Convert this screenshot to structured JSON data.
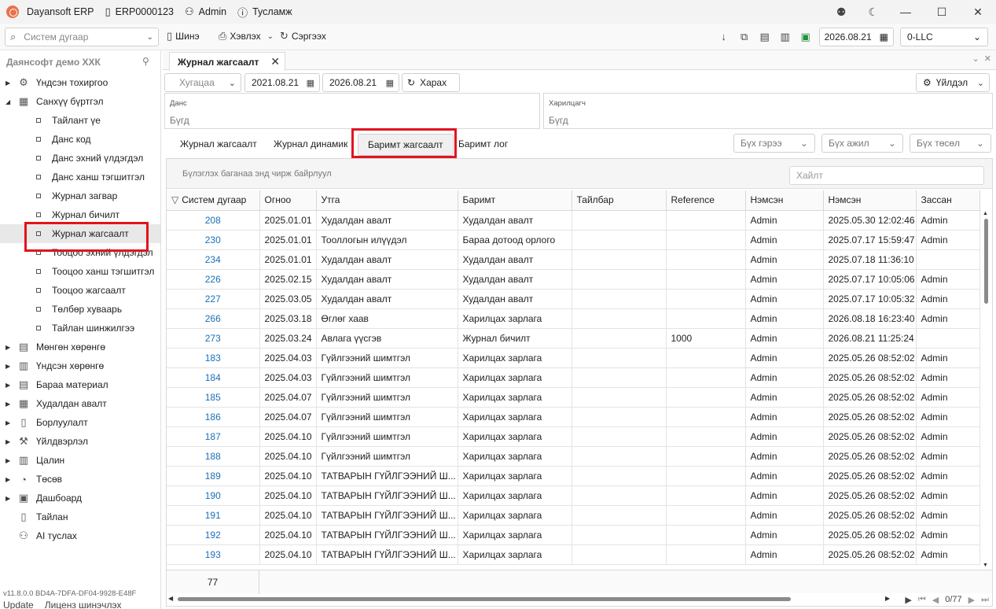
{
  "titlebar": {
    "app_name": "Dayansoft ERP",
    "db_name": "ERP0000123",
    "user": "Admin",
    "help": "Тусламж",
    "minimize": "—",
    "maximize": "☐",
    "close": "✕"
  },
  "toolbar": {
    "search_placeholder": "Систем дугаар",
    "new_label": "Шинэ",
    "print_label": "Хэвлэх",
    "refresh_label": "Сэргээх",
    "work_date": "2026.08.21",
    "company": "0-LLC"
  },
  "sidebar": {
    "title": "Даянсофт демо ХХК",
    "items": [
      {
        "label": "Үндсэн тохиргоо",
        "icon": "gear-icon",
        "glyph": "⚙",
        "arrow": "▶"
      },
      {
        "label": "Санхүү бүртгэл",
        "icon": "ledger-icon",
        "glyph": "▦",
        "arrow": "◢"
      },
      {
        "label": "Мөнгөн хөрөнгө",
        "icon": "money-icon",
        "glyph": "▤",
        "arrow": "▶"
      },
      {
        "label": "Үндсэн хөрөнгө",
        "icon": "asset-icon",
        "glyph": "▥",
        "arrow": "▶"
      },
      {
        "label": "Бараа материал",
        "icon": "inventory-icon",
        "glyph": "▤",
        "arrow": "▶"
      },
      {
        "label": "Худалдан авалт",
        "icon": "purchase-icon",
        "glyph": "▦",
        "arrow": "▶"
      },
      {
        "label": "Борлуулалт",
        "icon": "sales-icon",
        "glyph": "▯",
        "arrow": "▶"
      },
      {
        "label": "Үйлдвэрлэл",
        "icon": "production-icon",
        "glyph": "⚒",
        "arrow": "▶"
      },
      {
        "label": "Цалин",
        "icon": "salary-icon",
        "glyph": "▥",
        "arrow": "▶"
      },
      {
        "label": "Төсөв",
        "icon": "budget-icon",
        "glyph": "◔",
        "arrow": "▶"
      },
      {
        "label": "Дашбоард",
        "icon": "dashboard-icon",
        "glyph": "▣",
        "arrow": "▶"
      },
      {
        "label": "Тайлан",
        "icon": "report-icon",
        "glyph": "▯",
        "arrow": ""
      },
      {
        "label": "AI туслах",
        "icon": "ai-assistant-icon",
        "glyph": "⚇",
        "arrow": ""
      }
    ],
    "children": [
      "Тайлант үе",
      "Данс код",
      "Данс эхний үлдэгдэл",
      "Данс ханш тэгшитгэл",
      "Журнал загвар",
      "Журнал бичилт",
      "Журнал жагсаалт",
      "Тооцоо эхний үлдэгдэл",
      "Тооцоо ханш тэгшитгэл",
      "Тооцоо жагсаалт",
      "Төлбөр хуваарь",
      "Тайлан шинжилгээ"
    ],
    "version": "v11.8.0.0   BD4A-7DFA-DF04-9928-E48F",
    "update_label": "Update",
    "license_label": "Лиценз шинэчлэх"
  },
  "tab": {
    "title": "Журнал жагсаалт"
  },
  "filters": {
    "period_placeholder": "Хугацаа",
    "date_from": "2021.08.21",
    "date_to": "2026.08.21",
    "show_label": "Харах",
    "action_label": "Үйлдэл",
    "account_label": "Данс",
    "account_value": "Бүгд",
    "partner_label": "Харилцагч",
    "partner_value": "Бүгд"
  },
  "sub_tabs": [
    "Журнал жагсаалт",
    "Журнал динамик",
    "Баримт жагсаалт",
    "Баримт лог"
  ],
  "dropdowns": [
    "Бүх гэрээ",
    "Бүх ажил",
    "Бүх төсөл"
  ],
  "grid": {
    "group_hint": "Бүлэглэх баганаа энд чирж байрлуул",
    "search_placeholder": "Хайлт",
    "columns": [
      "Систем дугаар",
      "Огноо",
      "Утга",
      "Баримт",
      "Тайлбар",
      "Reference",
      "Нэмсэн",
      "Нэмсэн",
      "Зассан"
    ],
    "rows": [
      [
        "208",
        "2025.01.01",
        "Худалдан авалт",
        "Худалдан авалт",
        "",
        "",
        "Admin",
        "2025.05.30 12:02:46",
        "Admin"
      ],
      [
        "230",
        "2025.01.01",
        "Тооллогын илүүдэл",
        "Бараа дотоод орлого",
        "",
        "",
        "Admin",
        "2025.07.17 15:59:47",
        "Admin"
      ],
      [
        "234",
        "2025.01.01",
        "Худалдан авалт",
        "Худалдан авалт",
        "",
        "",
        "Admin",
        "2025.07.18 11:36:10",
        ""
      ],
      [
        "226",
        "2025.02.15",
        "Худалдан авалт",
        "Худалдан авалт",
        "",
        "",
        "Admin",
        "2025.07.17 10:05:06",
        "Admin"
      ],
      [
        "227",
        "2025.03.05",
        "Худалдан авалт",
        "Худалдан авалт",
        "",
        "",
        "Admin",
        "2025.07.17 10:05:32",
        "Admin"
      ],
      [
        "266",
        "2025.03.18",
        "Өглөг хаав",
        "Харилцах зарлага",
        "",
        "",
        "Admin",
        "2026.08.18 16:23:40",
        "Admin"
      ],
      [
        "273",
        "2025.03.24",
        "Авлага үүсгэв",
        "Журнал бичилт",
        "",
        "1000",
        "Admin",
        "2026.08.21 11:25:24",
        ""
      ],
      [
        "183",
        "2025.04.03",
        "Гүйлгээний  шимтгэл",
        "Харилцах зарлага",
        "",
        "",
        "Admin",
        "2025.05.26 08:52:02",
        "Admin"
      ],
      [
        "184",
        "2025.04.03",
        "Гүйлгээний  шимтгэл",
        "Харилцах зарлага",
        "",
        "",
        "Admin",
        "2025.05.26 08:52:02",
        "Admin"
      ],
      [
        "185",
        "2025.04.07",
        "Гүйлгээний  шимтгэл",
        "Харилцах зарлага",
        "",
        "",
        "Admin",
        "2025.05.26 08:52:02",
        "Admin"
      ],
      [
        "186",
        "2025.04.07",
        "Гүйлгээний  шимтгэл",
        "Харилцах зарлага",
        "",
        "",
        "Admin",
        "2025.05.26 08:52:02",
        "Admin"
      ],
      [
        "187",
        "2025.04.10",
        "Гүйлгээний  шимтгэл",
        "Харилцах зарлага",
        "",
        "",
        "Admin",
        "2025.05.26 08:52:02",
        "Admin"
      ],
      [
        "188",
        "2025.04.10",
        "Гүйлгээний  шимтгэл",
        "Харилцах зарлага",
        "",
        "",
        "Admin",
        "2025.05.26 08:52:02",
        "Admin"
      ],
      [
        "189",
        "2025.04.10",
        "ТАТВАРЫН ГҮЙЛГЭЭНИЙ Ш...",
        "Харилцах зарлага",
        "",
        "",
        "Admin",
        "2025.05.26 08:52:02",
        "Admin"
      ],
      [
        "190",
        "2025.04.10",
        "ТАТВАРЫН ГҮЙЛГЭЭНИЙ Ш...",
        "Харилцах зарлага",
        "",
        "",
        "Admin",
        "2025.05.26 08:52:02",
        "Admin"
      ],
      [
        "191",
        "2025.04.10",
        "ТАТВАРЫН ГҮЙЛГЭЭНИЙ Ш...",
        "Харилцах зарлага",
        "",
        "",
        "Admin",
        "2025.05.26 08:52:02",
        "Admin"
      ],
      [
        "192",
        "2025.04.10",
        "ТАТВАРЫН ГҮЙЛГЭЭНИЙ Ш...",
        "Харилцах зарлага",
        "",
        "",
        "Admin",
        "2025.05.26 08:52:02",
        "Admin"
      ],
      [
        "193",
        "2025.04.10",
        "ТАТВАРЫН ГҮЙЛГЭЭНИЙ Ш...",
        "Харилцах зарлага",
        "",
        "",
        "Admin",
        "2025.05.26 08:52:02",
        "Admin"
      ]
    ],
    "row_count": "77",
    "page_info": "0/77"
  },
  "colors": {
    "highlight": "#e1141e",
    "link": "#1a6fb8"
  }
}
